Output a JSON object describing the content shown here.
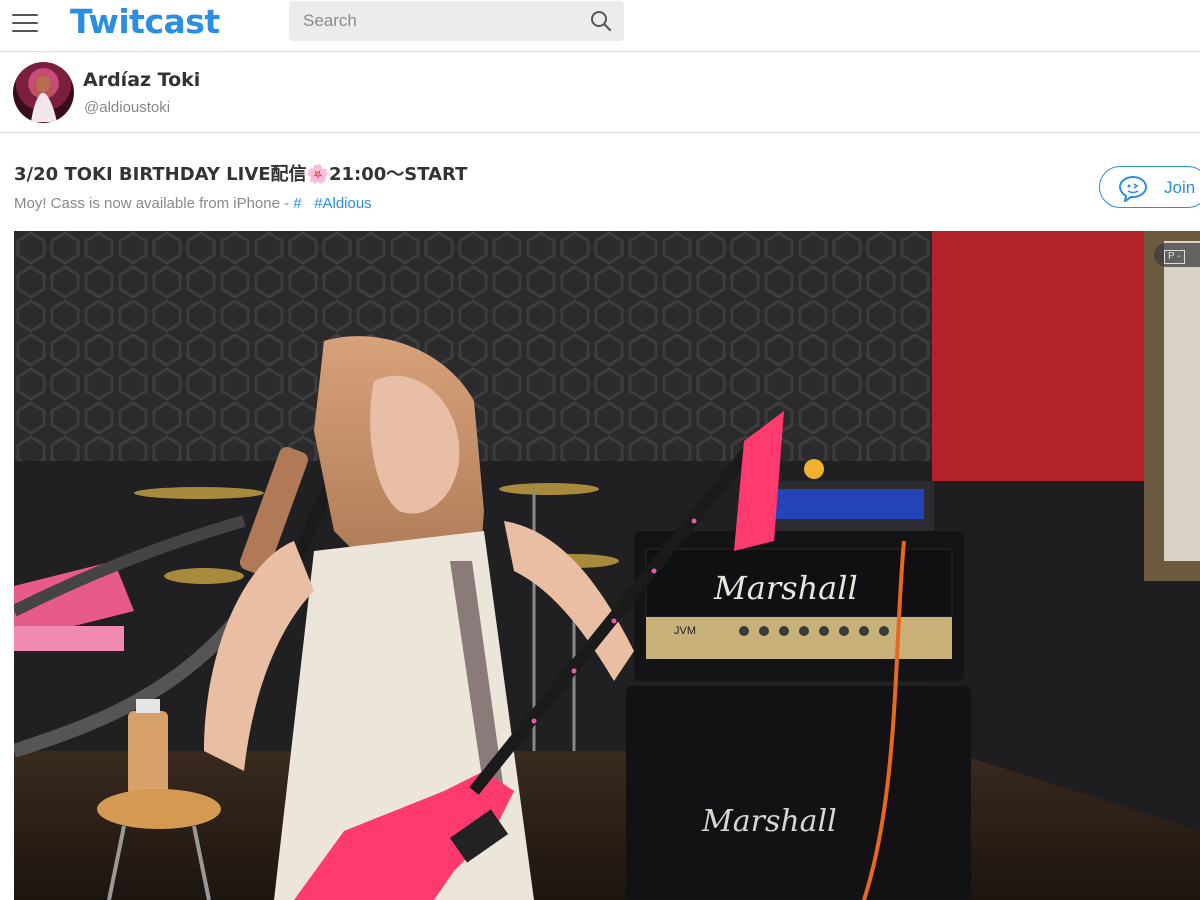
{
  "header": {
    "logo_text": "Twitcast",
    "search_placeholder": "Search",
    "menu_icon": "hamburger-menu-icon",
    "search_icon": "search-icon",
    "brand_color": "#2b8ee2"
  },
  "broadcaster": {
    "name": "Ardíaz Toki",
    "handle": "@aldioustoki"
  },
  "live": {
    "title": "3/20 TOKI BIRTHDAY LIVE配信🌸21:00〜START",
    "subtitle_text": "Moy! Cass is now available from iPhone - ",
    "subtitle_hash": "#",
    "subtitle_tag": "#Aldious",
    "join_label": "Join",
    "join_icon": "chat-bubble-icon"
  },
  "video": {
    "badge_text": "P -",
    "amp_brand_top": "Marshall",
    "amp_brand_bottom": "Marshall",
    "amp_model": "JVM"
  }
}
